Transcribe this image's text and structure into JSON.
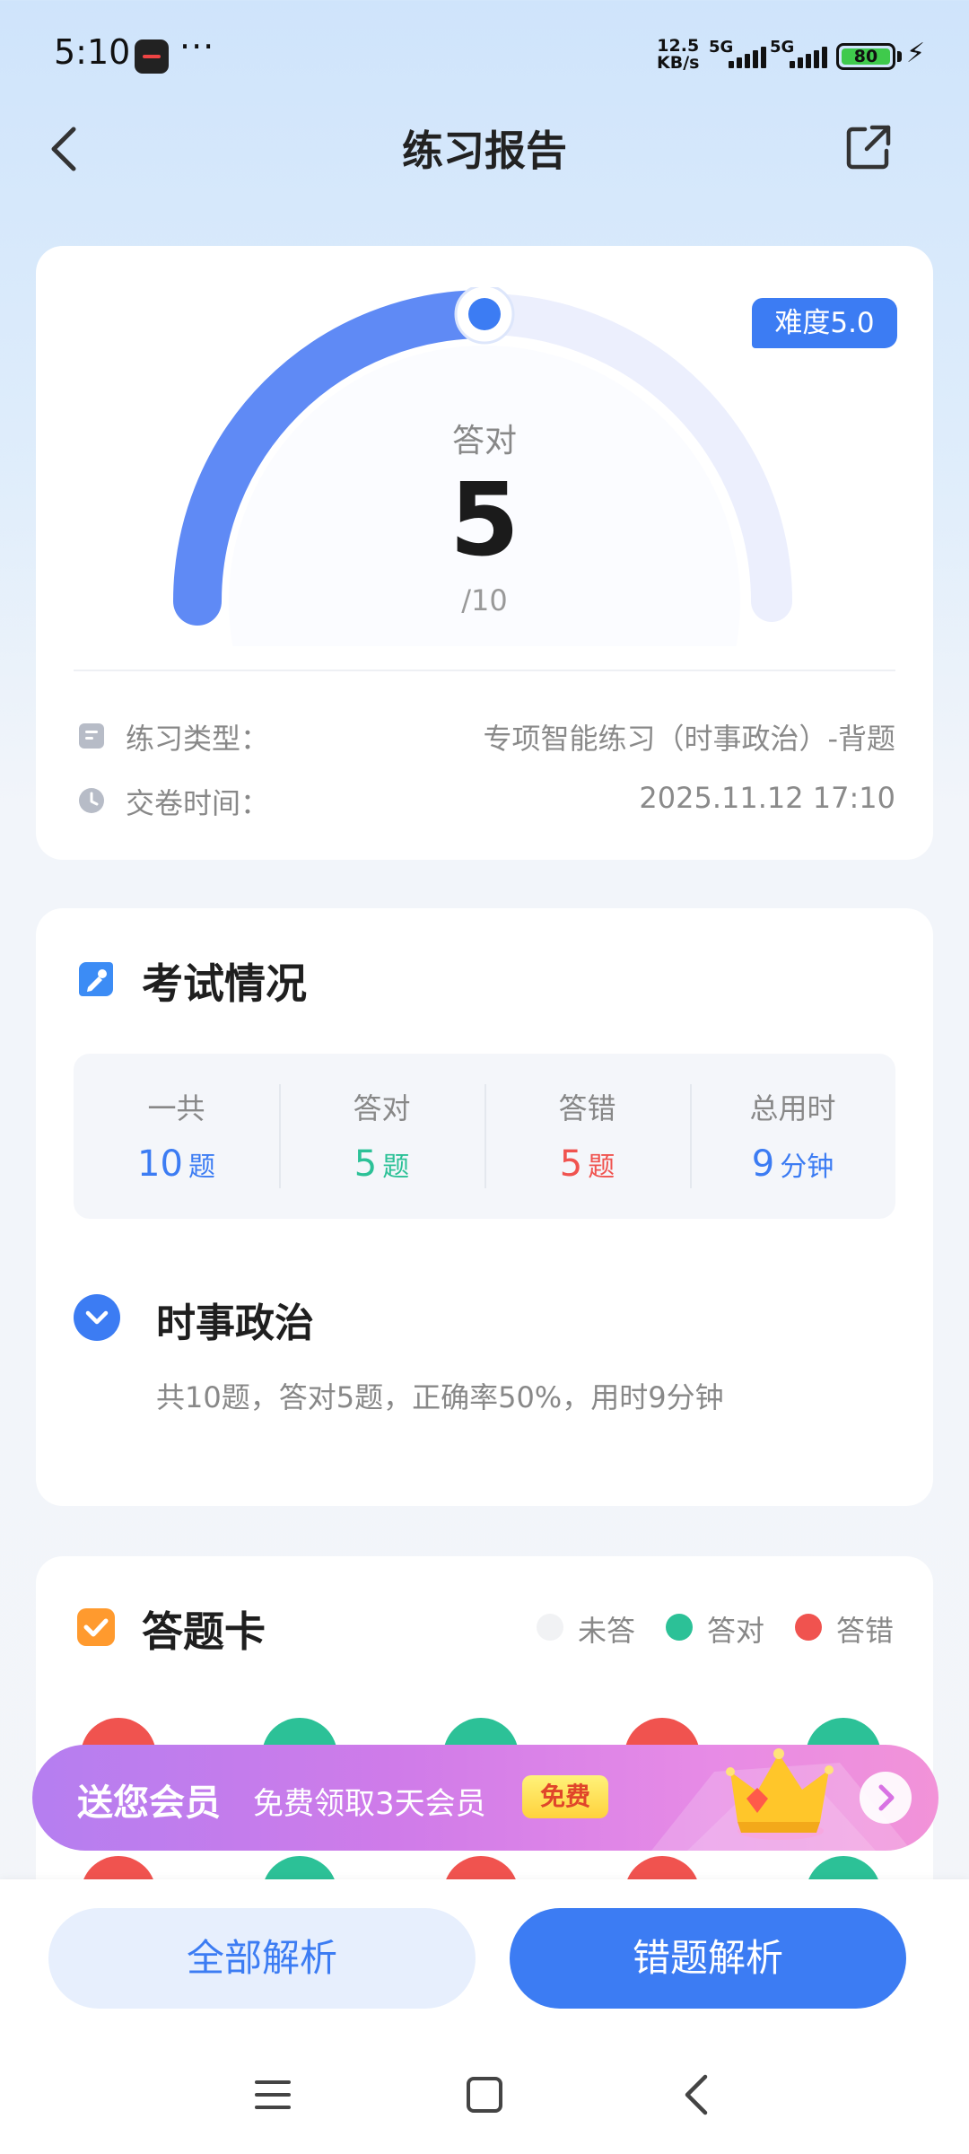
{
  "status_bar": {
    "time": "5:10",
    "more": "···",
    "net_speed_value": "12.5",
    "net_speed_unit": "KB/s",
    "sim1": "5G",
    "sim2": "5G",
    "battery": "80"
  },
  "header": {
    "title": "练习报告",
    "back_icon": "chevron-left-icon",
    "share_icon": "share-external-icon"
  },
  "report": {
    "difficulty": "难度5.0",
    "score_label": "答对",
    "score_value": "5",
    "score_total": "/10",
    "correct": 5,
    "total": 10,
    "gauge_color": "#5f8af5",
    "gauge_track_color": "#eceffd",
    "info": [
      {
        "icon": "document-icon",
        "label": "练习类型：",
        "value": "专项智能练习（时事政治）-背题"
      },
      {
        "icon": "clock-icon",
        "label": "交卷时间：",
        "value": "2025.11.12 17:10"
      }
    ]
  },
  "exam": {
    "title": "考试情况",
    "stats": [
      {
        "label": "一共",
        "value": "10",
        "unit": "题",
        "color": "#3c7cf3"
      },
      {
        "label": "答对",
        "value": "5",
        "unit": "题",
        "color": "#2cc197"
      },
      {
        "label": "答错",
        "value": "5",
        "unit": "题",
        "color": "#f0534f"
      },
      {
        "label": "总用时",
        "value": "9",
        "unit": "分钟",
        "color": "#3c7cf3"
      }
    ],
    "subject_title": "时事政治",
    "subject_desc": "共10题，答对5题，正确率50%，用时9分钟"
  },
  "answer_card": {
    "title": "答题卡",
    "legend": [
      {
        "label": "未答",
        "color": "#f1f2f4"
      },
      {
        "label": "答对",
        "color": "#2cc197"
      },
      {
        "label": "答错",
        "color": "#f0534f"
      }
    ],
    "answers": [
      "wrong",
      "correct",
      "correct",
      "wrong",
      "correct",
      "wrong",
      "correct",
      "wrong",
      "wrong",
      "correct"
    ],
    "colors": {
      "wrong": "#f0534f",
      "correct": "#2cc197",
      "unanswered": "#f1f2f4"
    }
  },
  "promo": {
    "title": "送您会员",
    "subtitle": "免费领取3天会员",
    "badge": "免费"
  },
  "actions": {
    "all_analysis": "全部解析",
    "wrong_analysis": "错题解析"
  }
}
